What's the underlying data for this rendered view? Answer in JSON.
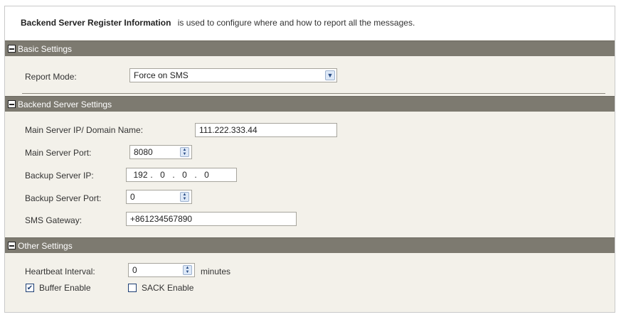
{
  "intro": {
    "title": "Backend Server Register Information",
    "description": "is used to configure where and how to report all the messages."
  },
  "basic": {
    "section_title": "Basic Settings",
    "report_mode_label": "Report Mode:",
    "report_mode_value": "Force on SMS"
  },
  "backend": {
    "section_title": "Backend Server Settings",
    "main_ip_label": "Main Server IP/ Domain Name:",
    "main_ip_value": "111.222.333.44",
    "main_port_label": "Main Server Port:",
    "main_port_value": "8080",
    "backup_ip_label": "Backup Server IP:",
    "backup_ip_octets": [
      "192",
      "0",
      "0",
      "0"
    ],
    "backup_port_label": "Backup Server Port:",
    "backup_port_value": "0",
    "sms_gateway_label": "SMS Gateway:",
    "sms_gateway_value": "+861234567890"
  },
  "other": {
    "section_title": "Other Settings",
    "heartbeat_label": "Heartbeat Interval:",
    "heartbeat_value": "0",
    "heartbeat_unit": "minutes",
    "buffer_label": "Buffer Enable",
    "buffer_checked": true,
    "sack_label": "SACK Enable",
    "sack_checked": false
  },
  "icons": {
    "collapse": "minus-box-icon",
    "dropdown": "chevron-down-icon",
    "spinner": "spinner-arrows-icon",
    "check": "checkmark-icon"
  }
}
